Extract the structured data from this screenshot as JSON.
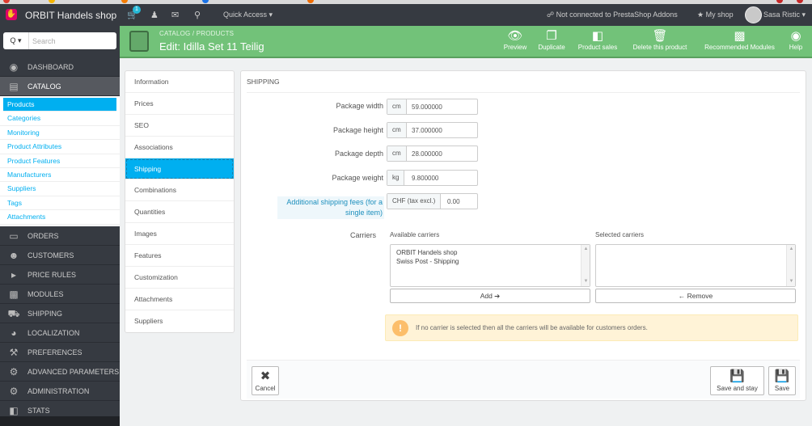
{
  "topbar": {
    "shop_name": "ORBIT Handels shop",
    "cart_badge": "1",
    "quick_access": "Quick Access ▾",
    "addons_status": "Not connected to PrestaShop Addons",
    "my_shop": "★ My shop",
    "user_name": "Sasa Ristic ▾"
  },
  "sidebar": {
    "search_placeholder": "Search",
    "search_toggle": "Q ▾",
    "menu": [
      {
        "label": "DASHBOARD",
        "icon": "dashboard-icon"
      },
      {
        "label": "CATALOG",
        "icon": "book-icon"
      },
      {
        "label": "ORDERS",
        "icon": "credit-card-icon"
      },
      {
        "label": "CUSTOMERS",
        "icon": "users-icon"
      },
      {
        "label": "PRICE RULES",
        "icon": "tag-icon"
      },
      {
        "label": "MODULES",
        "icon": "puzzle-icon"
      },
      {
        "label": "SHIPPING",
        "icon": "truck-icon"
      },
      {
        "label": "LOCALIZATION",
        "icon": "globe-icon"
      },
      {
        "label": "PREFERENCES",
        "icon": "wrench-icon"
      },
      {
        "label": "ADVANCED PARAMETERS",
        "icon": "cogs-icon"
      },
      {
        "label": "ADMINISTRATION",
        "icon": "gear-icon"
      },
      {
        "label": "STATS",
        "icon": "bar-chart-icon"
      }
    ],
    "catalog_submenu": [
      "Products",
      "Categories",
      "Monitoring",
      "Product Attributes",
      "Product Features",
      "Manufacturers",
      "Suppliers",
      "Tags",
      "Attachments"
    ]
  },
  "header": {
    "breadcrumb": "CATALOG  /  PRODUCTS",
    "title": "Edit: Idilla Set 11 Teilig",
    "actions": [
      "Preview",
      "Duplicate",
      "Product sales",
      "Delete this product",
      "Recommended Modules",
      "Help"
    ]
  },
  "tabs": [
    "Information",
    "Prices",
    "SEO",
    "Associations",
    "Shipping",
    "Combinations",
    "Quantities",
    "Images",
    "Features",
    "Customization",
    "Attachments",
    "Suppliers"
  ],
  "shipping": {
    "heading": "SHIPPING",
    "width": {
      "label": "Package width",
      "unit": "cm",
      "value": "59.000000"
    },
    "height": {
      "label": "Package height",
      "unit": "cm",
      "value": "37.000000"
    },
    "depth": {
      "label": "Package depth",
      "unit": "cm",
      "value": "28.000000"
    },
    "weight": {
      "label": "Package weight",
      "unit": "kg",
      "value": "9.800000"
    },
    "fees": {
      "label": "Additional shipping fees (for a single item)",
      "unit": "CHF (tax excl.)",
      "value": "0.00"
    },
    "carriers_label": "Carriers",
    "available_title": "Available carriers",
    "selected_title": "Selected carriers",
    "available": [
      "ORBIT Handels shop",
      "Swiss Post - Shipping"
    ],
    "add_label": "Add ➔",
    "remove_label": "← Remove",
    "alert": "If no carrier is selected then all the carriers will be available for customers orders.",
    "cancel_label": "Cancel",
    "save_stay_label": "Save and stay",
    "save_label": "Save"
  },
  "colors": {
    "accent": "#00aff0",
    "header_green": "#72c279",
    "sidebar": "#363a41"
  }
}
